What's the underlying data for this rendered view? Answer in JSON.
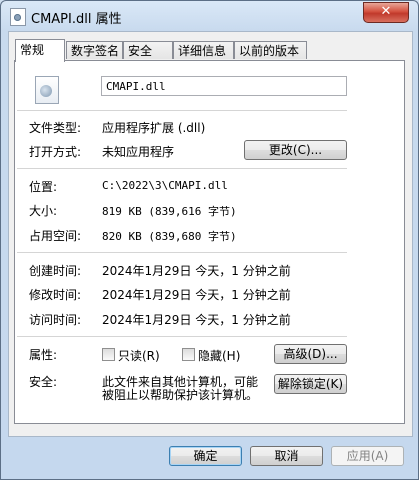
{
  "window": {
    "title": "CMAPI.dll 属性",
    "close_symbol": "✕"
  },
  "tabs": [
    "常规",
    "数字签名",
    "安全",
    "详细信息",
    "以前的版本"
  ],
  "general": {
    "file_name": "CMAPI.dll",
    "file_type_label": "文件类型:",
    "file_type_value": "应用程序扩展 (.dll)",
    "opens_with_label": "打开方式:",
    "opens_with_value": "未知应用程序",
    "change_button": "更改(C)...",
    "location_label": "位置:",
    "location_value": "C:\\2022\\3\\CMAPI.dll",
    "size_label": "大小:",
    "size_value": "819 KB (839,616 字节)",
    "size_on_disk_label": "占用空间:",
    "size_on_disk_value": "820 KB (839,680 字节)",
    "created_label": "创建时间:",
    "created_value": "2024年1月29日 今天，1 分钟之前",
    "modified_label": "修改时间:",
    "modified_value": "2024年1月29日 今天，1 分钟之前",
    "accessed_label": "访问时间:",
    "accessed_value": "2024年1月29日 今天，1 分钟之前",
    "attributes_label": "属性:",
    "readonly_label": "只读(R)",
    "readonly_checked": false,
    "hidden_label": "隐藏(H)",
    "hidden_checked": false,
    "advanced_button": "高级(D)...",
    "security_label": "安全:",
    "security_text_line1": "此文件来自其他计算机，可能",
    "security_text_line2": "被阻止以帮助保护该计算机。",
    "unblock_button": "解除锁定(K)"
  },
  "footer": {
    "ok_button": "确定",
    "cancel_button": "取消",
    "apply_button": "应用(A)"
  }
}
